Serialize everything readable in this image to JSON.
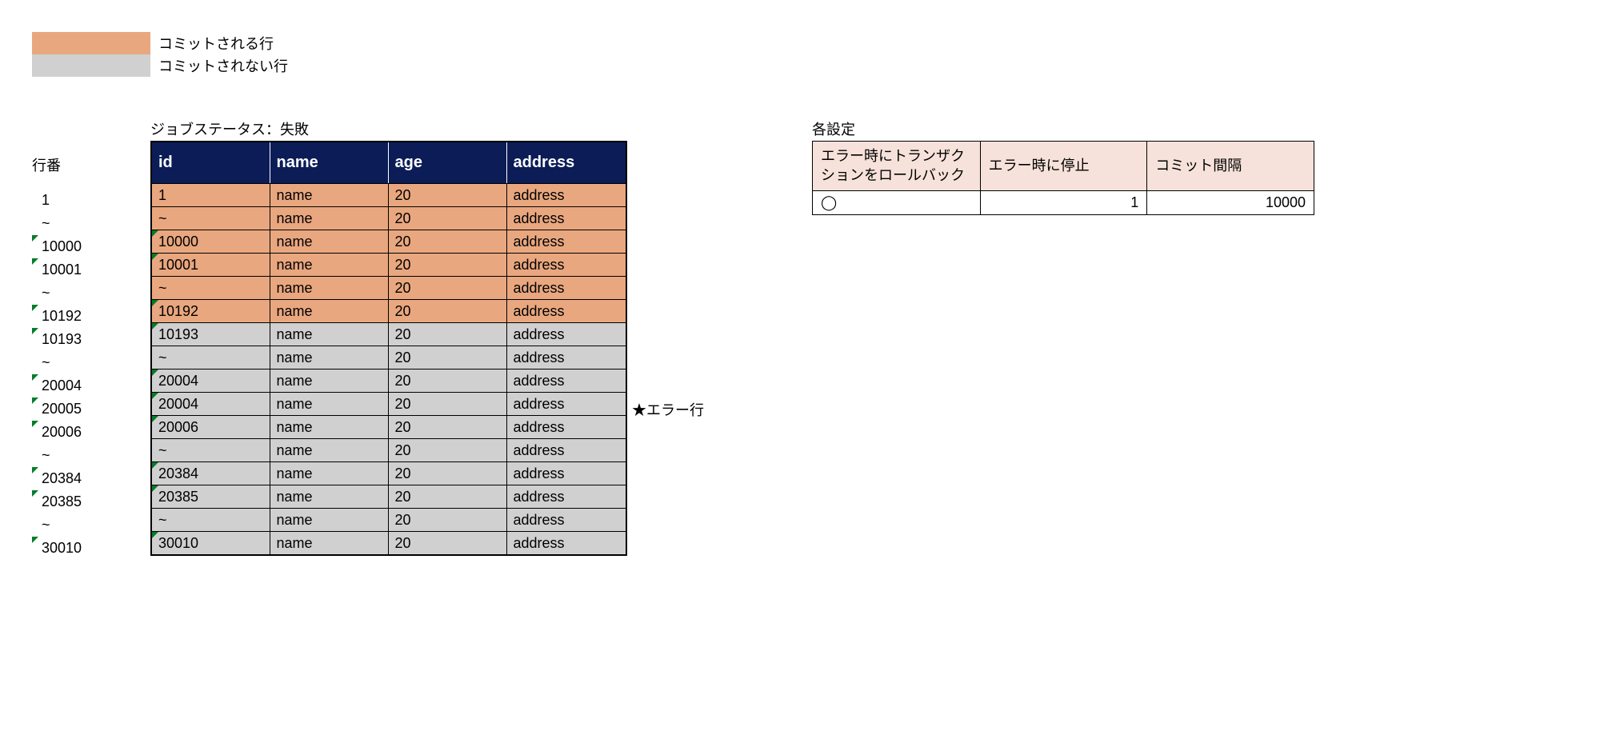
{
  "legend": {
    "committed": "コミットされる行",
    "uncommitted": "コミットされない行"
  },
  "rowno_header": "行番",
  "table_title": "ジョブステータス：失敗",
  "columns": {
    "id": "id",
    "name": "name",
    "age": "age",
    "address": "address"
  },
  "rows": [
    {
      "rowno": "1",
      "tickRow": false,
      "id": "1",
      "tickId": false,
      "name": "name",
      "age": "20",
      "address": "address",
      "cls": "orange",
      "annot": ""
    },
    {
      "rowno": "~",
      "tickRow": false,
      "id": "~",
      "tickId": false,
      "name": "name",
      "age": "20",
      "address": "address",
      "cls": "orange",
      "annot": ""
    },
    {
      "rowno": "10000",
      "tickRow": true,
      "id": "10000",
      "tickId": true,
      "name": "name",
      "age": "20",
      "address": "address",
      "cls": "orange",
      "annot": ""
    },
    {
      "rowno": "10001",
      "tickRow": true,
      "id": "10001",
      "tickId": true,
      "name": "name",
      "age": "20",
      "address": "address",
      "cls": "orange",
      "annot": ""
    },
    {
      "rowno": "~",
      "tickRow": false,
      "id": "~",
      "tickId": false,
      "name": "name",
      "age": "20",
      "address": "address",
      "cls": "orange",
      "annot": ""
    },
    {
      "rowno": "10192",
      "tickRow": true,
      "id": "10192",
      "tickId": true,
      "name": "name",
      "age": "20",
      "address": "address",
      "cls": "orange",
      "annot": ""
    },
    {
      "rowno": "10193",
      "tickRow": true,
      "id": "10193",
      "tickId": true,
      "name": "name",
      "age": "20",
      "address": "address",
      "cls": "gray",
      "annot": ""
    },
    {
      "rowno": "~",
      "tickRow": false,
      "id": "~",
      "tickId": false,
      "name": "name",
      "age": "20",
      "address": "address",
      "cls": "gray",
      "annot": ""
    },
    {
      "rowno": "20004",
      "tickRow": true,
      "id": "20004",
      "tickId": true,
      "name": "name",
      "age": "20",
      "address": "address",
      "cls": "gray",
      "annot": ""
    },
    {
      "rowno": "20005",
      "tickRow": true,
      "id": "20004",
      "tickId": true,
      "name": "name",
      "age": "20",
      "address": "address",
      "cls": "gray",
      "annot": "★エラー行"
    },
    {
      "rowno": "20006",
      "tickRow": true,
      "id": "20006",
      "tickId": true,
      "name": "name",
      "age": "20",
      "address": "address",
      "cls": "gray",
      "annot": ""
    },
    {
      "rowno": "~",
      "tickRow": false,
      "id": "~",
      "tickId": false,
      "name": "name",
      "age": "20",
      "address": "address",
      "cls": "gray",
      "annot": ""
    },
    {
      "rowno": "20384",
      "tickRow": true,
      "id": "20384",
      "tickId": true,
      "name": "name",
      "age": "20",
      "address": "address",
      "cls": "gray",
      "annot": ""
    },
    {
      "rowno": "20385",
      "tickRow": true,
      "id": "20385",
      "tickId": true,
      "name": "name",
      "age": "20",
      "address": "address",
      "cls": "gray",
      "annot": ""
    },
    {
      "rowno": "~",
      "tickRow": false,
      "id": "~",
      "tickId": false,
      "name": "name",
      "age": "20",
      "address": "address",
      "cls": "gray",
      "annot": ""
    },
    {
      "rowno": "30010",
      "tickRow": true,
      "id": "30010",
      "tickId": true,
      "name": "name",
      "age": "20",
      "address": "address",
      "cls": "gray",
      "annot": ""
    }
  ],
  "settings": {
    "title": "各設定",
    "h1": "エラー時にトランザクションをロールバック",
    "h2": "エラー時に停止",
    "h3": "コミット間隔",
    "v1": "◯",
    "v2": "1",
    "v3": "10000"
  }
}
